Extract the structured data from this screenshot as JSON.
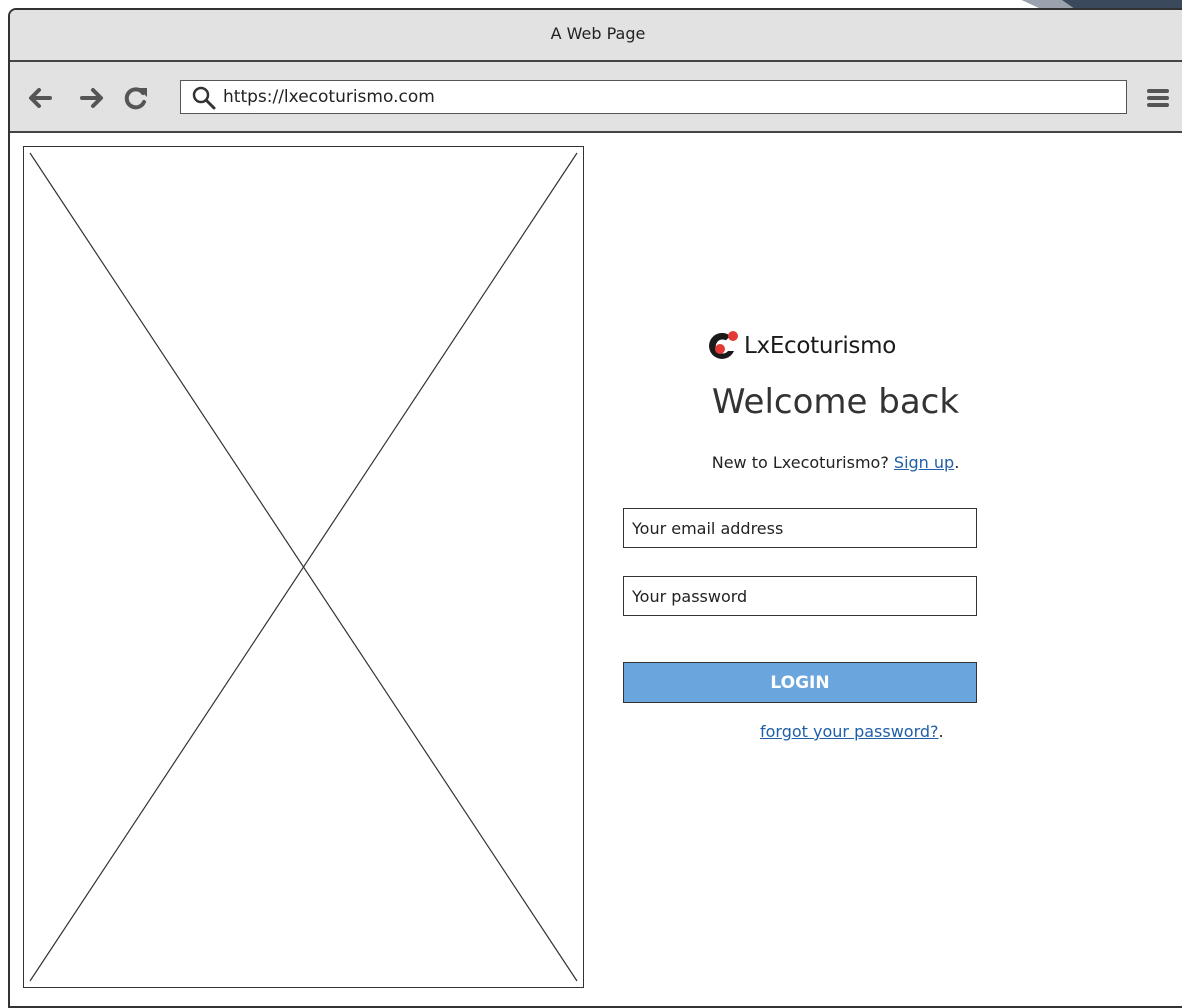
{
  "window": {
    "title": "A Web Page"
  },
  "navbar": {
    "back_icon": "arrow-left-icon",
    "forward_icon": "arrow-right-icon",
    "reload_icon": "reload-icon",
    "search_icon": "search-icon",
    "menu_icon": "hamburger-menu-icon",
    "url": "https://lxecoturismo.com"
  },
  "login": {
    "logo_text": "LxEcoturismo",
    "logo_colors": {
      "mark": "#1a1a1a",
      "accent": "#e53935"
    },
    "heading": "Welcome back",
    "signup_prompt": "New to Lxecoturismo?",
    "signup_link": "Sign up",
    "signup_suffix": ".",
    "email_placeholder": "Your email address",
    "password_placeholder": "Your password",
    "login_label": "LOGIN",
    "login_color": "#6aa6dd",
    "forgot_link": "forgot your password?",
    "forgot_suffix": "."
  }
}
